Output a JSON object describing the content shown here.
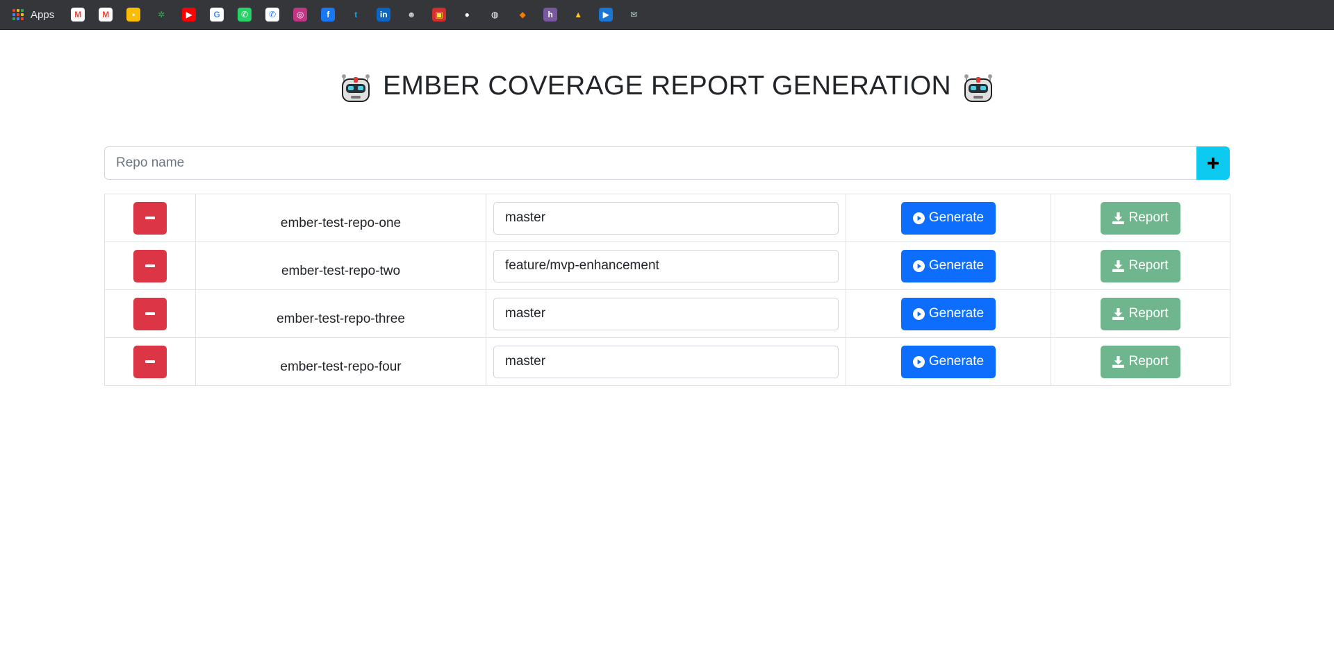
{
  "bookmarks": {
    "apps_label": "Apps",
    "items": [
      {
        "name": "gmail-icon",
        "glyph": "M",
        "bg": "#ffffff",
        "fg": "#ea4335"
      },
      {
        "name": "gmail-icon-2",
        "glyph": "M",
        "bg": "#ffffff",
        "fg": "#ea4335"
      },
      {
        "name": "keep-icon",
        "glyph": "▪",
        "bg": "#fbbc04",
        "fg": "#ffffff"
      },
      {
        "name": "photos-icon",
        "glyph": "✲",
        "bg": "#35363a",
        "fg": "#34a853"
      },
      {
        "name": "youtube-icon",
        "glyph": "▶",
        "bg": "#ff0000",
        "fg": "#ffffff"
      },
      {
        "name": "google-icon",
        "glyph": "G",
        "bg": "#ffffff",
        "fg": "#4285f4"
      },
      {
        "name": "whatsapp-icon",
        "glyph": "✆",
        "bg": "#25d366",
        "fg": "#ffffff"
      },
      {
        "name": "phone-icon",
        "glyph": "✆",
        "bg": "#ffffff",
        "fg": "#1a73e8"
      },
      {
        "name": "instagram-icon",
        "glyph": "◎",
        "bg": "#c13584",
        "fg": "#ffffff"
      },
      {
        "name": "facebook-icon",
        "glyph": "f",
        "bg": "#1877f2",
        "fg": "#ffffff"
      },
      {
        "name": "twitter-icon",
        "glyph": "t",
        "bg": "#35363a",
        "fg": "#1da1f2"
      },
      {
        "name": "linkedin-icon",
        "glyph": "in",
        "bg": "#0a66c2",
        "fg": "#ffffff"
      },
      {
        "name": "hacker-icon",
        "glyph": "☻",
        "bg": "#35363a",
        "fg": "#cccccc"
      },
      {
        "name": "news-icon",
        "glyph": "▣",
        "bg": "#d32f2f",
        "fg": "#ffeb3b"
      },
      {
        "name": "github-icon",
        "glyph": "●",
        "bg": "#35363a",
        "fg": "#ffffff"
      },
      {
        "name": "globe-icon",
        "glyph": "◍",
        "bg": "#35363a",
        "fg": "#ffffff"
      },
      {
        "name": "box-icon",
        "glyph": "◆",
        "bg": "#35363a",
        "fg": "#f57c00"
      },
      {
        "name": "heroku-icon",
        "glyph": "h",
        "bg": "#79589f",
        "fg": "#ffffff"
      },
      {
        "name": "firebase-icon",
        "glyph": "▲",
        "bg": "#35363a",
        "fg": "#ffca28"
      },
      {
        "name": "play-circle-icon",
        "glyph": "▶",
        "bg": "#1976d2",
        "fg": "#ffffff"
      },
      {
        "name": "mail-open-icon",
        "glyph": "✉",
        "bg": "#35363a",
        "fg": "#a7d8d8"
      }
    ]
  },
  "header": {
    "title": "EMBER COVERAGE REPORT GENERATION"
  },
  "add_repo": {
    "placeholder": "Repo name",
    "value": ""
  },
  "repos": [
    {
      "name": "ember-test-repo-one",
      "branch": "master"
    },
    {
      "name": "ember-test-repo-two",
      "branch": "feature/mvp-enhancement"
    },
    {
      "name": "ember-test-repo-three",
      "branch": "master"
    },
    {
      "name": "ember-test-repo-four",
      "branch": "master"
    }
  ],
  "actions": {
    "generate_label": "Generate",
    "report_label": "Report"
  },
  "colors": {
    "remove": "#dc3545",
    "generate": "#0d6efd",
    "report": "#6fb68e",
    "add": "#0dcaf0"
  }
}
